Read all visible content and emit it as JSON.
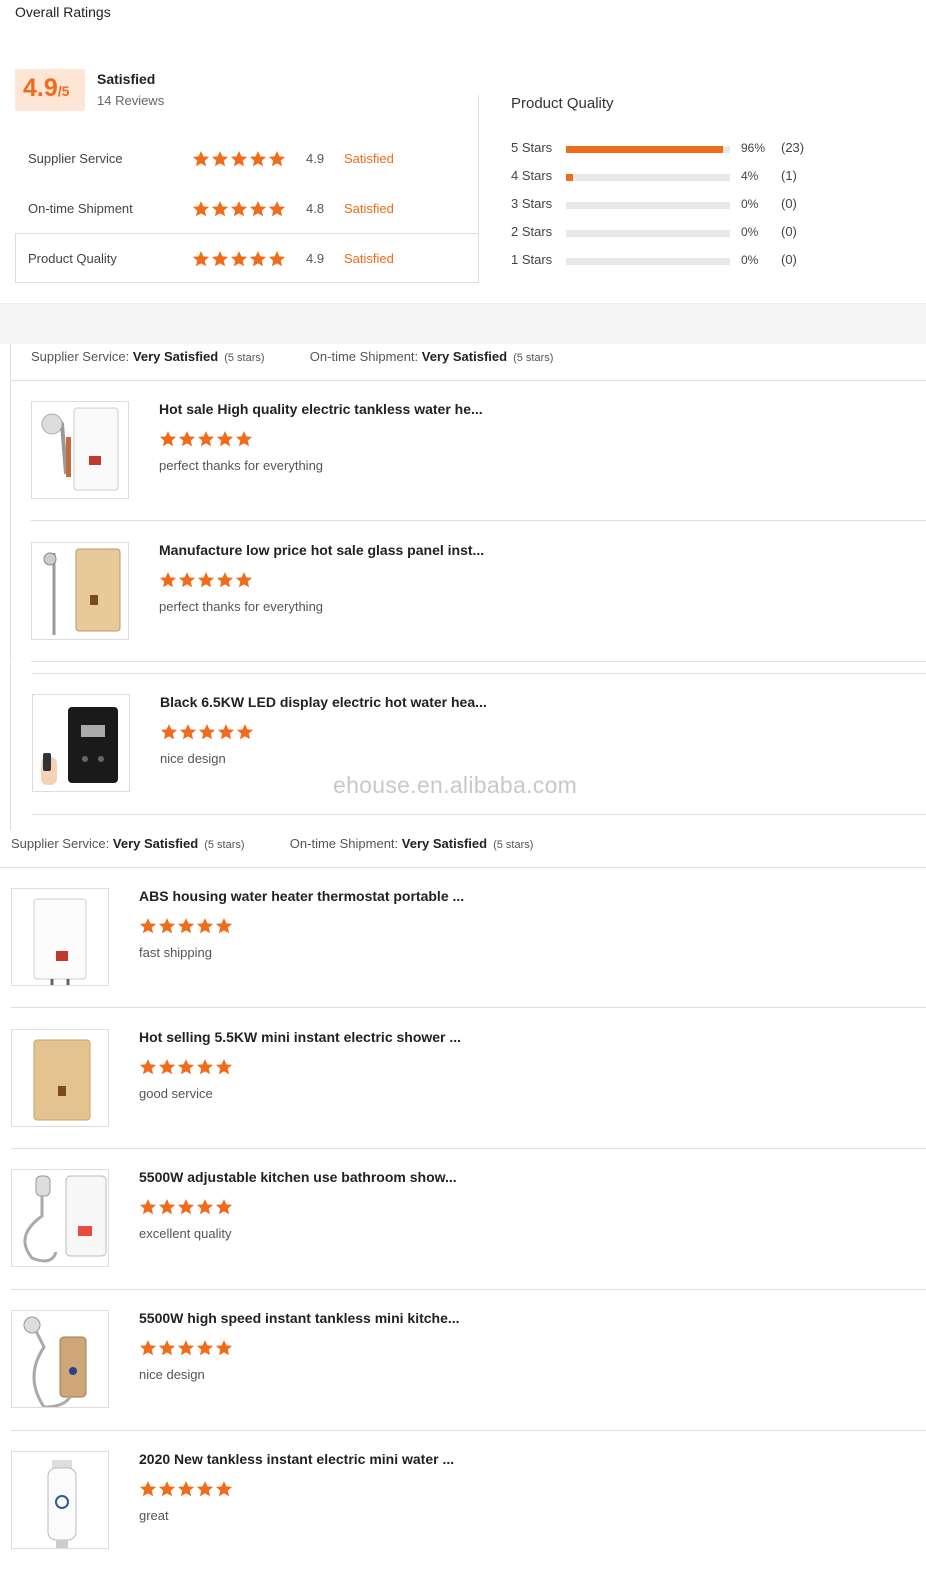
{
  "header": {
    "title": "Overall Ratings"
  },
  "overall": {
    "score": "4.9",
    "suffix": "/5",
    "label": "Satisfied",
    "reviews": "14 Reviews"
  },
  "ratings": [
    {
      "label": "Supplier Service",
      "stars": 5,
      "value": "4.9",
      "status": "Satisfied"
    },
    {
      "label": "On-time Shipment",
      "stars": 5,
      "value": "4.8",
      "status": "Satisfied"
    },
    {
      "label": "Product Quality",
      "stars": 5,
      "value": "4.9",
      "status": "Satisfied"
    }
  ],
  "distribution": {
    "title": "Product Quality",
    "rows": [
      {
        "label": "5  Stars",
        "fraction": 0.96,
        "pct": "96%",
        "count": "(23)"
      },
      {
        "label": "4  Stars",
        "fraction": 0.04,
        "pct": "4%",
        "count": "(1)"
      },
      {
        "label": "3  Stars",
        "fraction": 0,
        "pct": "0%",
        "count": "(0)"
      },
      {
        "label": "2  Stars",
        "fraction": 0,
        "pct": "0%",
        "count": "(0)"
      },
      {
        "label": "1  Stars",
        "fraction": 0,
        "pct": "0%",
        "count": "(0)"
      }
    ]
  },
  "review_groups": [
    {
      "supplier_label": "Supplier Service:",
      "supplier_value": "Very Satisfied",
      "supplier_stars": "(5 stars)",
      "shipment_label": "On-time Shipment:",
      "shipment_value": "Very Satisfied",
      "shipment_stars": "(5 stars)"
    },
    {
      "supplier_label": "Supplier Service:",
      "supplier_value": "Very Satisfied",
      "supplier_stars": "(5 stars)",
      "shipment_label": "On-time Shipment:",
      "shipment_value": "Very Satisfied",
      "shipment_stars": "(5 stars)"
    }
  ],
  "reviews": [
    {
      "title": "Hot sale High quality electric tankless water he...",
      "stars": 5,
      "comment": "perfect thanks for everything",
      "image": "water-heater-white-shower"
    },
    {
      "title": "Manufacture low price hot sale glass panel inst...",
      "stars": 5,
      "comment": "perfect thanks for everything",
      "image": "water-heater-gold-shower"
    },
    {
      "title": "Black 6.5KW LED display electric hot water hea...",
      "stars": 5,
      "comment": "nice design",
      "image": "water-heater-black-remote"
    },
    {
      "title": "ABS housing water heater thermostat portable ...",
      "stars": 5,
      "comment": "fast shipping",
      "image": "water-heater-white"
    },
    {
      "title": "Hot selling 5.5KW mini instant electric shower ...",
      "stars": 5,
      "comment": "good service",
      "image": "water-heater-gold"
    },
    {
      "title": "5500W adjustable kitchen use bathroom show...",
      "stars": 5,
      "comment": "excellent quality",
      "image": "water-heater-white-hose"
    },
    {
      "title": "5500W high speed instant tankless mini kitche...",
      "stars": 5,
      "comment": "nice design",
      "image": "water-heater-mini-gold"
    },
    {
      "title": "2020 New tankless instant electric mini water ...",
      "stars": 5,
      "comment": "great",
      "image": "water-heater-mini-white"
    }
  ],
  "watermark": "ehouse.en.alibaba.com",
  "colors": {
    "accent": "#f06b1a",
    "score_bg": "#fde6d5",
    "border": "#dddddd"
  }
}
